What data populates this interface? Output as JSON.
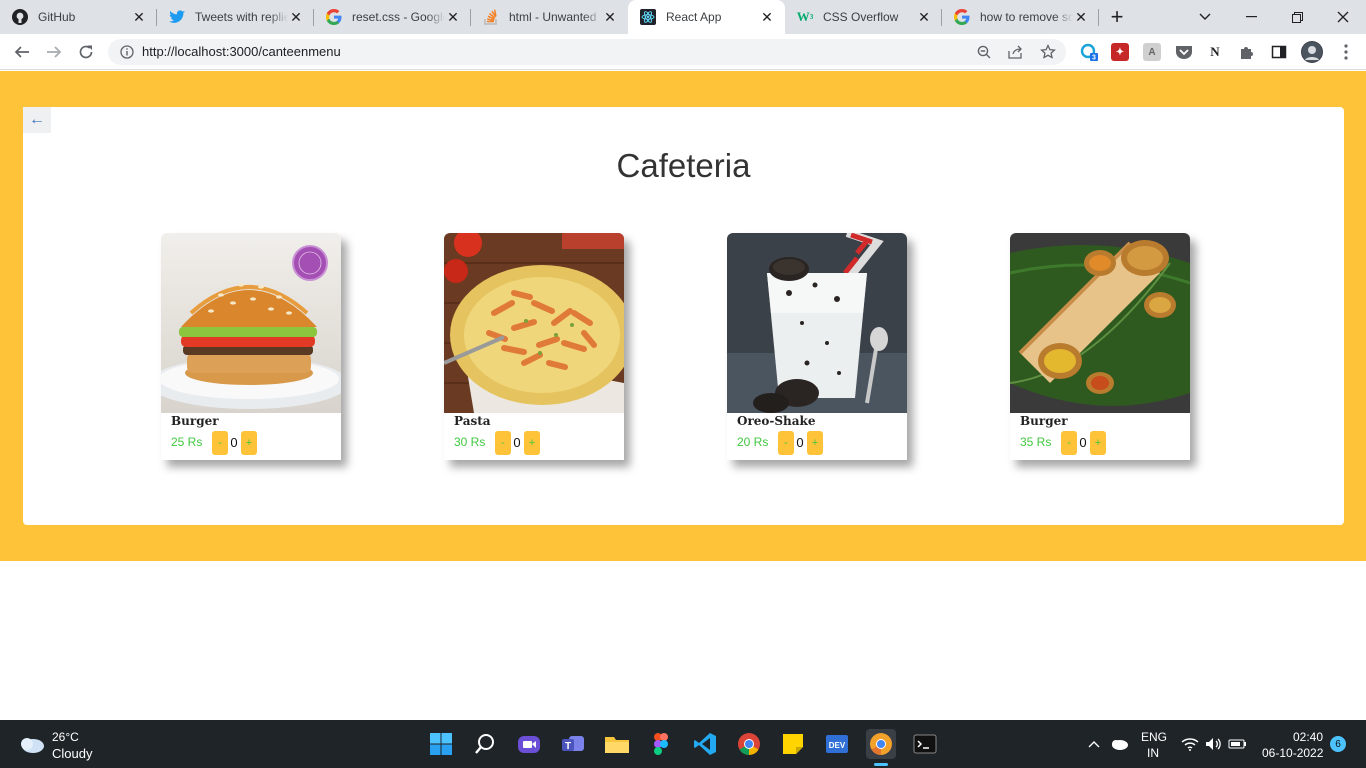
{
  "browser": {
    "tabs": [
      {
        "title": "GitHub",
        "icon": "github-icon"
      },
      {
        "title": "Tweets with replies",
        "icon": "twitter-icon"
      },
      {
        "title": "reset.css - Google Search",
        "icon": "google-icon"
      },
      {
        "title": "html - Unwanted",
        "icon": "stackoverflow-icon"
      },
      {
        "title": "React App",
        "icon": "react-icon",
        "active": true
      },
      {
        "title": "CSS Overflow",
        "icon": "w3schools-icon"
      },
      {
        "title": "how to remove scroll",
        "icon": "google-icon"
      }
    ],
    "url": "http://localhost:3000/canteenmenu",
    "extension_badge": "3"
  },
  "page": {
    "title": "Cafeteria",
    "accent_color": "#ffc339",
    "price_color": "#41c741",
    "items": [
      {
        "name": "Burger",
        "price": "25 Rs",
        "qty": "0",
        "minus": "-",
        "plus": "+"
      },
      {
        "name": "Pasta",
        "price": "30 Rs",
        "qty": "0",
        "minus": "-",
        "plus": "+"
      },
      {
        "name": "Oreo-Shake",
        "price": "20 Rs",
        "qty": "0",
        "minus": "-",
        "plus": "+"
      },
      {
        "name": "Burger",
        "price": "35 Rs",
        "qty": "0",
        "minus": "-",
        "plus": "+"
      }
    ]
  },
  "taskbar": {
    "weather_temp": "26°C",
    "weather_desc": "Cloudy",
    "lang_line1": "ENG",
    "lang_line2": "IN",
    "time": "02:40",
    "date": "06-10-2022",
    "notification_count": "6"
  }
}
